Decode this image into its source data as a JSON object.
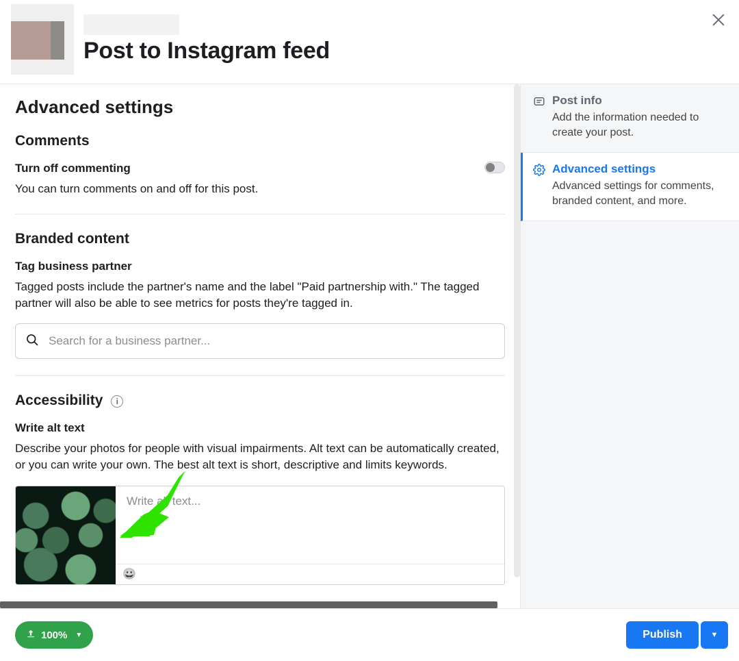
{
  "header": {
    "title": "Post to Instagram feed"
  },
  "section_title": "Advanced settings",
  "comments": {
    "heading": "Comments",
    "toggle_label": "Turn off commenting",
    "toggle_desc": "You can turn comments on and off for this post.",
    "toggle_on": false
  },
  "branded": {
    "heading": "Branded content",
    "sub_label": "Tag business partner",
    "sub_desc": "Tagged posts include the partner's name and the label \"Paid partnership with.\" The tagged partner will also be able to see metrics for posts they're tagged in.",
    "search_placeholder": "Search for a business partner..."
  },
  "accessibility": {
    "heading": "Accessibility",
    "sub_label": "Write alt text",
    "sub_desc": "Describe your photos for people with visual impairments. Alt text can be automatically created, or you can write your own. The best alt text is short, descriptive and limits keywords.",
    "textarea_placeholder": "Write alt text..."
  },
  "sidebar": {
    "items": [
      {
        "title": "Post info",
        "desc": "Add the information needed to create your post."
      },
      {
        "title": "Advanced settings",
        "desc": "Advanced settings for comments, branded content, and more."
      }
    ]
  },
  "footer": {
    "upload_status": "100%",
    "publish_label": "Publish"
  },
  "colors": {
    "primary": "#1877f2",
    "success": "#31a24c",
    "annotation_arrow": "#2ee300"
  }
}
